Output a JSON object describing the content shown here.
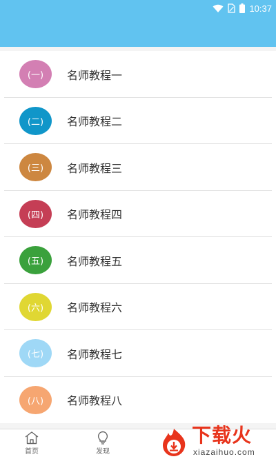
{
  "status_bar": {
    "time": "10:37",
    "icons": [
      "wifi-icon",
      "sim-icon",
      "battery-icon"
    ]
  },
  "colors": {
    "header": "#61c3f0",
    "badges": [
      "#d37fb3",
      "#1096c9",
      "#cd8740",
      "#c53e55",
      "#3aa13c",
      "#e0d733",
      "#9fd8f6",
      "#f6a671"
    ]
  },
  "list": {
    "items": [
      {
        "badge": "(一)",
        "label": "名师教程一"
      },
      {
        "badge": "(二)",
        "label": "名师教程二"
      },
      {
        "badge": "(三)",
        "label": "名师教程三"
      },
      {
        "badge": "(四)",
        "label": "名师教程四"
      },
      {
        "badge": "(五)",
        "label": "名师教程五"
      },
      {
        "badge": "(六)",
        "label": "名师教程六"
      },
      {
        "badge": "(七)",
        "label": "名师教程七"
      },
      {
        "badge": "(八)",
        "label": "名师教程八"
      }
    ]
  },
  "bottom_nav": {
    "tabs": [
      {
        "label": "首页",
        "icon": "home-icon"
      },
      {
        "label": "发现",
        "icon": "lightbulb-icon"
      }
    ]
  },
  "watermark": {
    "title": "下载火",
    "url": "xiazaihuo.com"
  }
}
